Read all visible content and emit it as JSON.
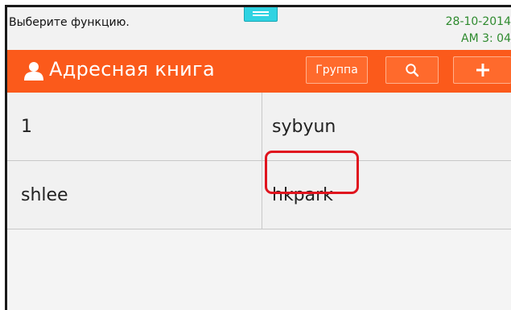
{
  "status": {
    "message": "Выберите функцию.",
    "date": "28-10-2014",
    "time": "AM 3: 04"
  },
  "header": {
    "title": "Адресная книга",
    "icon": "person-icon",
    "group_label": "Группа",
    "search_icon": "search-icon",
    "add_icon": "plus-icon"
  },
  "contacts": {
    "rows": [
      [
        "1",
        "sybyun"
      ],
      [
        "shlee",
        "hkpark"
      ]
    ]
  },
  "colors": {
    "accent": "#fb5a1b",
    "status_text": "#2e8a2e",
    "highlight": "#e0141e"
  }
}
